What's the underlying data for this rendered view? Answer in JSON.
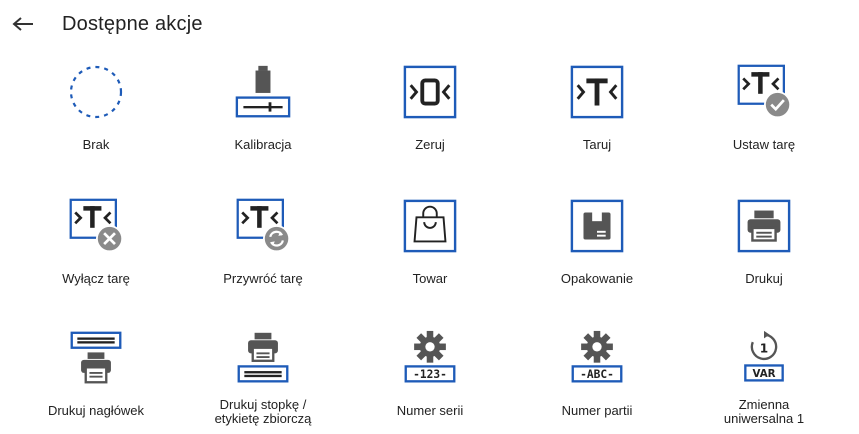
{
  "header": {
    "title": "Dostępne akcje",
    "back_icon": "arrow-left-icon"
  },
  "colors": {
    "accent": "#1e5bb8",
    "icon_gray": "#555555",
    "badge_gray": "#8a8a8a"
  },
  "actions": [
    {
      "label": "Brak",
      "icon": "dashed-circle-icon"
    },
    {
      "label": "Kalibracja",
      "icon": "calibration-icon"
    },
    {
      "label": "Zeruj",
      "icon": "zero-icon"
    },
    {
      "label": "Taruj",
      "icon": "tare-icon"
    },
    {
      "label": "Ustaw tarę",
      "icon": "set-tare-icon"
    },
    {
      "label": "Wyłącz tarę",
      "icon": "disable-tare-icon"
    },
    {
      "label": "Przywróć tarę",
      "icon": "restore-tare-icon"
    },
    {
      "label": "Towar",
      "icon": "product-bag-icon"
    },
    {
      "label": "Opakowanie",
      "icon": "packaging-icon"
    },
    {
      "label": "Drukuj",
      "icon": "printer-icon"
    },
    {
      "label": "Drukuj nagłówek",
      "icon": "print-header-icon"
    },
    {
      "label": "Drukuj stopkę /",
      "label2": "etykietę zbiorczą",
      "icon": "print-footer-icon"
    },
    {
      "label": "Numer serii",
      "icon": "batch-number-icon",
      "code": "-123-"
    },
    {
      "label": "Numer partii",
      "icon": "lot-number-icon",
      "code": "-ABC-"
    },
    {
      "label": "Zmienna",
      "label2": "uniwersalna 1",
      "icon": "universal-variable-icon",
      "code": "VAR",
      "digit": "1"
    }
  ]
}
